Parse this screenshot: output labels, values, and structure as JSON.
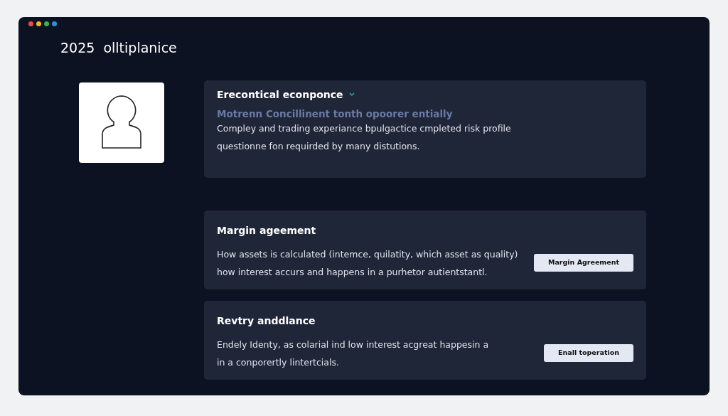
{
  "window": {
    "title": "2025  olltiplanice"
  },
  "sections": [
    {
      "title": "Erecontical econponce",
      "subtitle": "Motrenn Concillinent tonth opoorer entially",
      "lines": [
        "Compley and trading experiance bpulgactice cmpleted risk profile",
        "questionne fon requirded by many distutions."
      ]
    },
    {
      "title": "Margin ageement",
      "lines": [
        "How assets is calculated (intemce, quilatity, which asset as quality)",
        "how interest accurs and happens in a purhetor autientstantl."
      ],
      "button": "Margin Agreement"
    },
    {
      "title": "Revtry anddlance",
      "lines": [
        "Endely Identy, as colarial ind low interest acgreat happesin a",
        "in a conporertly lintertcials."
      ],
      "button": "Enall toperation"
    }
  ]
}
